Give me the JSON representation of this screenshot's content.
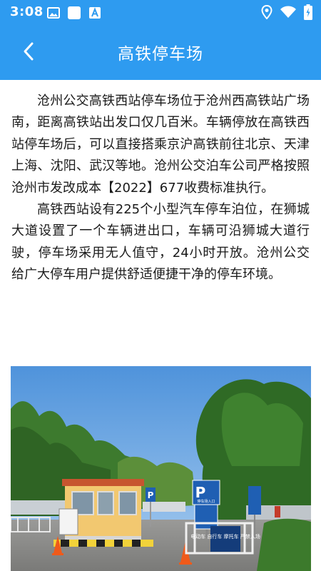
{
  "status_bar": {
    "time": "3:08",
    "left_icons": [
      "gallery-icon",
      "square-icon",
      "a-icon"
    ],
    "right_icons": [
      "location-icon",
      "wifi-icon",
      "battery-icon"
    ]
  },
  "header": {
    "title": "高铁停车场",
    "back_icon": "chevron-left-icon"
  },
  "article": {
    "paragraphs": [
      "沧州公交高铁西站停车场位于沧州西高铁站广场南，距离高铁站出发口仅几百米。车辆停放在高铁西站停车场后，可以直接搭乘京沪高铁前往北京、天津上海、沈阳、武汉等地。沧州公交泊车公司严格按照沧州市发改成本【2022】677收费标准执行。",
      "高铁西站设有225个小型汽车停车泊位，在狮城大道设置了一个车辆进出口，车辆可沿狮城大道行驶，停车场采用无人值守，24小时开放。沧州公交给广大停车用户提供舒适便捷干净的停车环境。"
    ]
  },
  "photo": {
    "sign_main": "P",
    "sign_main_sub": "停车场入口",
    "sign_lower": "电动车 自行车 摩托车 严禁入场",
    "sign_small": "P"
  },
  "colors": {
    "accent": "#2e9bf0",
    "text": "#1a1a1a"
  }
}
